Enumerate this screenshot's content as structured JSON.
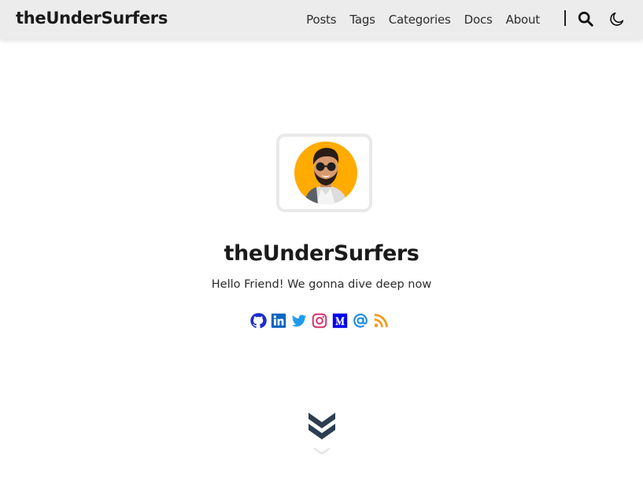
{
  "header": {
    "brand": "theUnderSurfers",
    "nav": [
      {
        "label": "Posts"
      },
      {
        "label": "Tags"
      },
      {
        "label": "Categories"
      },
      {
        "label": "Docs"
      },
      {
        "label": "About"
      }
    ],
    "icons": [
      "search-icon",
      "moon-icon"
    ]
  },
  "profile": {
    "title": "theUnderSurfers",
    "tagline": "Hello Friend! We gonna dive deep now",
    "avatar_background": "#ffab00"
  },
  "socials": [
    {
      "name": "github",
      "color": "#1a2dcf"
    },
    {
      "name": "linkedin",
      "color": "#0a66c2"
    },
    {
      "name": "twitter",
      "color": "#1da1f2"
    },
    {
      "name": "instagram",
      "color": "#d6336c"
    },
    {
      "name": "medium",
      "color": "#0000ee"
    },
    {
      "name": "email",
      "color": "#1b8be0"
    },
    {
      "name": "rss",
      "color": "#f29b1d"
    }
  ],
  "colors": {
    "navbar": "#ececec",
    "text": "#1a1a1a",
    "scroll_arrow": "#2c3e50"
  }
}
